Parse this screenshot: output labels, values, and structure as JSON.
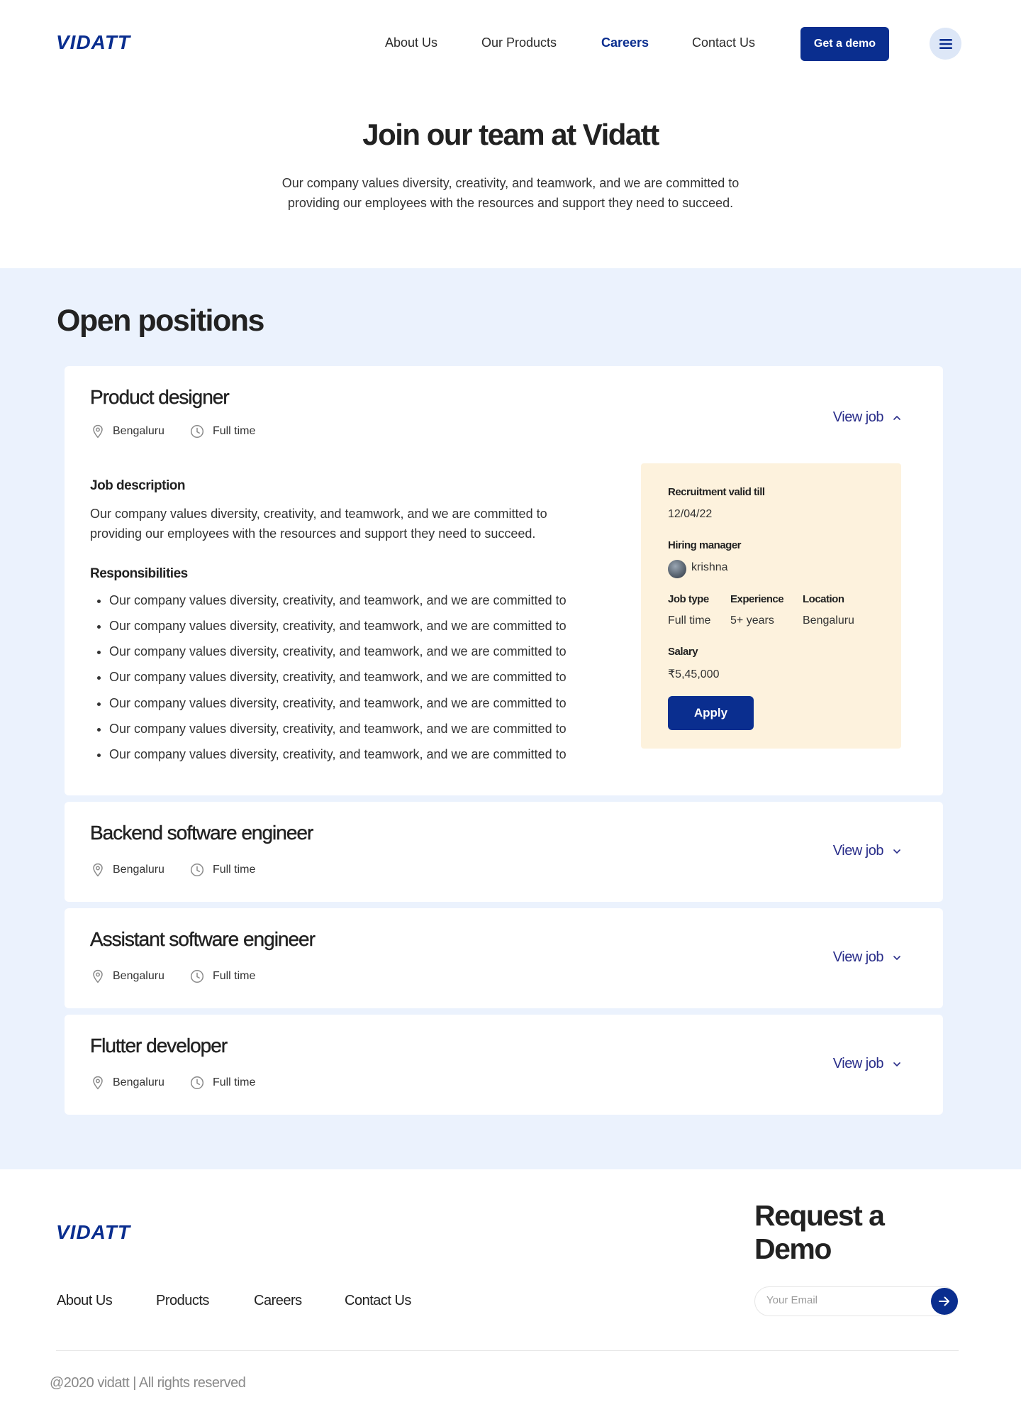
{
  "brand": {
    "logo_text": "VIDATT",
    "accent_color": "#0a2e8f",
    "section_bg": "#ebf2fd",
    "info_bg": "#fdf2dd"
  },
  "nav": {
    "items": [
      {
        "label": "About Us",
        "active": false
      },
      {
        "label": "Our Products",
        "active": false
      },
      {
        "label": "Careers",
        "active": true
      },
      {
        "label": "Contact Us",
        "active": false
      }
    ],
    "cta_label": "Get a demo",
    "menu_icon": "hamburger-icon"
  },
  "hero": {
    "title": "Join our team at Vidatt",
    "subtitle": "Our company values diversity, creativity, and teamwork, and we are committed to providing our employees with the resources and support they need to succeed."
  },
  "positions": {
    "title": "Open positions",
    "view_label": "View job",
    "jobs": [
      {
        "title": "Product designer",
        "location": "Bengaluru",
        "type": "Full time",
        "expanded": true,
        "description_heading": "Job description",
        "description": "Our company values diversity, creativity, and teamwork, and we are committed to providing our employees with the resources and support they need to succeed.",
        "responsibilities_heading": "Responsibilities",
        "responsibilities": [
          "Our company values diversity, creativity, and teamwork, and we are committed to",
          "Our company values diversity, creativity, and teamwork, and we are committed to",
          "Our company values diversity, creativity, and teamwork, and we are committed to",
          "Our company values diversity, creativity, and teamwork, and we are committed to",
          "Our company values diversity, creativity, and teamwork, and we are committed to",
          "Our company values diversity, creativity, and teamwork, and we are committed to",
          "Our company values diversity, creativity, and teamwork, and we are committed to"
        ],
        "details": {
          "valid_label": "Recruitment valid till",
          "valid_value": "12/04/22",
          "manager_label": "Hiring manager",
          "manager_value": "krishna",
          "job_type_label": "Job type",
          "job_type_value": "Full time",
          "experience_label": "Experience",
          "experience_value": "5+ years",
          "location_label": "Location",
          "location_value": "Bengaluru",
          "salary_label": "Salary",
          "salary_value": "₹5,45,000",
          "apply_label": "Apply"
        }
      },
      {
        "title": "Backend software engineer",
        "location": "Bengaluru",
        "type": "Full time",
        "expanded": false
      },
      {
        "title": "Assistant software engineer",
        "location": "Bengaluru",
        "type": "Full time",
        "expanded": false
      },
      {
        "title": "Flutter developer",
        "location": "Bengaluru",
        "type": "Full time",
        "expanded": false
      }
    ]
  },
  "footer": {
    "logo_text": "VIDATT",
    "links": [
      "About Us",
      "Products",
      "Careers",
      "Contact Us"
    ],
    "request_title": "Request a Demo",
    "email_placeholder": "Your Email",
    "copyright": "@2020 vidatt | All rights reserved"
  }
}
